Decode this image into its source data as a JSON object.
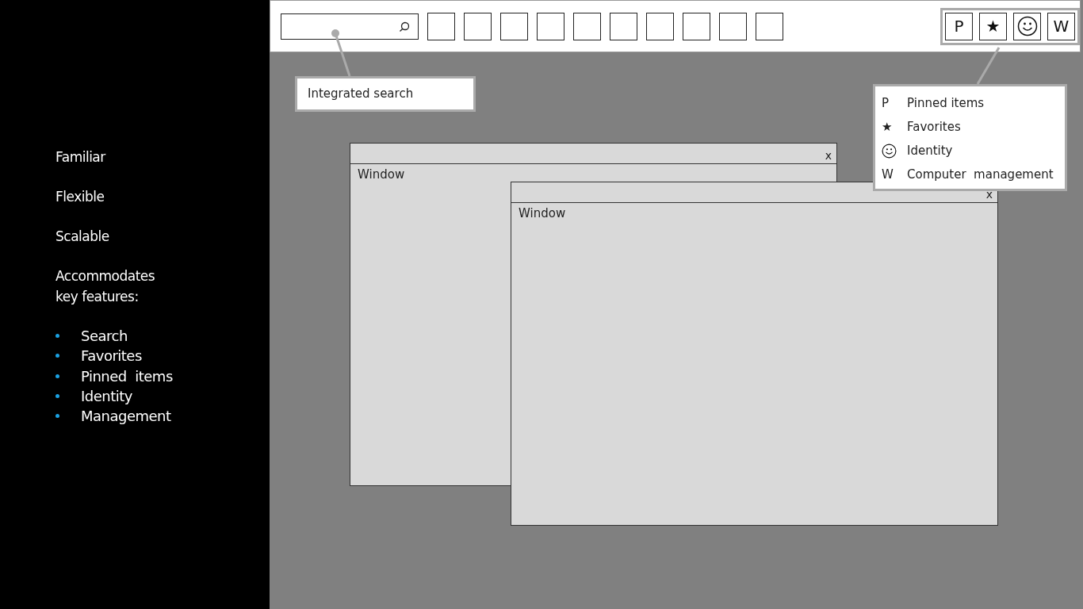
{
  "sidebar": {
    "items": [
      {
        "text": "Familiar"
      },
      {
        "text": "Flexible"
      },
      {
        "text": "Scalable"
      },
      {
        "text": "Accommodates key features:"
      }
    ],
    "bullets": [
      "Search",
      "Favorites",
      "Pinned  items",
      "Identity",
      "Management"
    ]
  },
  "quick_buttons": [
    {
      "kind": "glyph",
      "label": "P"
    },
    {
      "kind": "glyph",
      "label": "★"
    },
    {
      "kind": "smiley"
    },
    {
      "kind": "glyph",
      "label": "W"
    }
  ],
  "search_callout": {
    "text": "Integrated search"
  },
  "menu": {
    "items": [
      {
        "kind": "glyph",
        "glyph": "P",
        "label": "Pinned items"
      },
      {
        "kind": "glyph",
        "glyph": "★",
        "label": "Favorites"
      },
      {
        "kind": "smiley",
        "label": "Identity"
      },
      {
        "kind": "glyph",
        "glyph": "W",
        "label": "Computer  management"
      }
    ]
  },
  "windows": [
    {
      "title": "Window",
      "close": "x"
    },
    {
      "title": "Window",
      "close": "x"
    }
  ]
}
